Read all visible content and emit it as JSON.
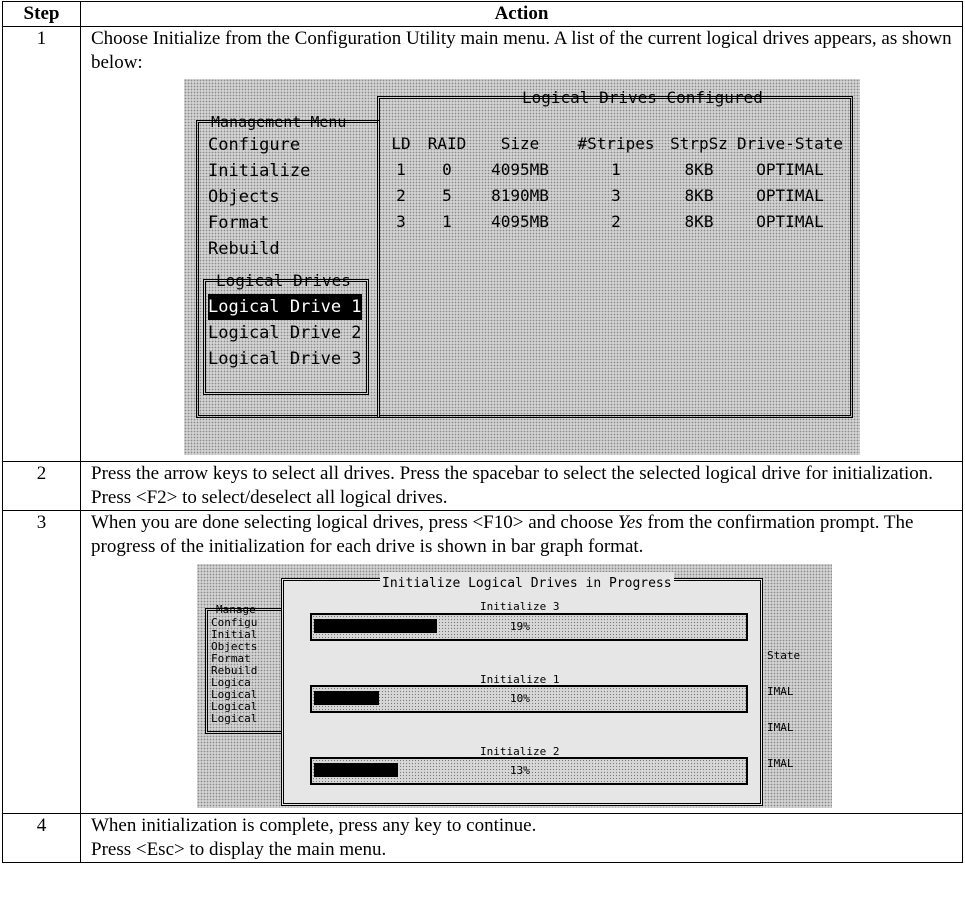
{
  "table": {
    "headers": [
      "Step",
      "Action"
    ],
    "steps": [
      {
        "num": "1",
        "text": "Choose Initialize from the Configuration Utility main menu. A list of the current logical drives appears, as shown below:"
      },
      {
        "num": "2",
        "text": "Press the arrow keys to select all drives. Press the spacebar to select the selected logical drive for initialization. Press <F2> to select/deselect all logical drives."
      },
      {
        "num": "3",
        "text_before": "When you are done selecting logical drives, press <F10> and choose ",
        "text_em": "Yes",
        "text_after": " from the confirmation prompt. The progress of the initialization for each drive is shown in bar graph format."
      },
      {
        "num": "4",
        "line1": "When initialization is complete, press any key to continue.",
        "line2": "Press <Esc> to display the main menu."
      }
    ]
  },
  "screen1": {
    "menu_title": "Management Menu",
    "menu_items": [
      "Configure",
      "Initialize",
      "Objects",
      "Format",
      "Rebuild"
    ],
    "submenu_title": "Logical Drives",
    "submenu_items": [
      "Logical Drive 1",
      "Logical Drive 2",
      "Logical Drive 3"
    ],
    "selected_item": "Logical Drive 1",
    "panel_title": "Logical Drives Configured",
    "columns": [
      "LD",
      "RAID",
      "Size",
      "#Stripes",
      "StrpSz",
      "Drive-State"
    ],
    "rows": [
      [
        "1",
        "0",
        "4095MB",
        "1",
        "8KB",
        "OPTIMAL"
      ],
      [
        "2",
        "5",
        "8190MB",
        "3",
        "8KB",
        "OPTIMAL"
      ],
      [
        "3",
        "1",
        "4095MB",
        "2",
        "8KB",
        "OPTIMAL"
      ]
    ]
  },
  "screen2": {
    "dialog_title": "Initialize Logical Drives in Progress",
    "bg_menu_title": "Manage",
    "bg_menu_items": [
      "Configu",
      "Initial",
      "Objects",
      "Format",
      "Rebuild"
    ],
    "bg_sub_title": "Logica",
    "bg_sub_items": [
      "Logical",
      "Logical",
      "Logical"
    ],
    "bg_right_header": "State",
    "bg_right_items": [
      "IMAL",
      "IMAL",
      "IMAL"
    ],
    "bars": [
      {
        "label": "Initialize 3",
        "percent_text": "19%",
        "progress": 0.19
      },
      {
        "label": "Initialize 1",
        "percent_text": "10%",
        "progress": 0.1
      },
      {
        "label": "Initialize 2",
        "percent_text": "13%",
        "progress": 0.13
      }
    ]
  }
}
